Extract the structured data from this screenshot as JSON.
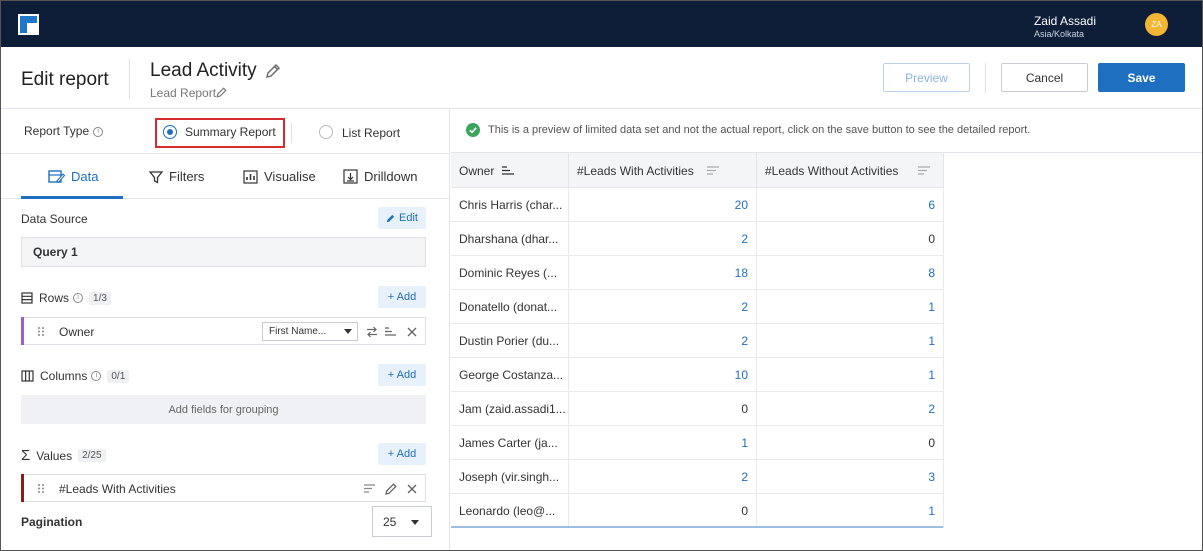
{
  "topbar": {
    "user_name": "Zaid Assadi",
    "user_timezone": "Asia/Kolkata",
    "avatar_initials": "ZA",
    "avatar_color": "#f2b632"
  },
  "header": {
    "page_title": "Edit report",
    "report_name": "Lead Activity",
    "report_subtitle": "Lead Report",
    "preview_label": "Preview",
    "cancel_label": "Cancel",
    "save_label": "Save"
  },
  "report_type": {
    "label": "Report Type",
    "options": [
      {
        "label": "Summary Report",
        "selected": true
      },
      {
        "label": "List Report",
        "selected": false
      }
    ]
  },
  "tabs": [
    {
      "label": "Data",
      "active": true,
      "icon": "data-icon"
    },
    {
      "label": "Filters",
      "active": false,
      "icon": "filter-icon"
    },
    {
      "label": "Visualise",
      "active": false,
      "icon": "chart-icon"
    },
    {
      "label": "Drilldown",
      "active": false,
      "icon": "drilldown-icon"
    }
  ],
  "data_source": {
    "label": "Data Source",
    "edit_label": "Edit",
    "query": "Query 1"
  },
  "rows_section": {
    "label": "Rows",
    "count": "1/3",
    "add_label": "+ Add",
    "items": [
      {
        "label": "Owner",
        "format": "First Name..."
      }
    ]
  },
  "columns_section": {
    "label": "Columns",
    "count": "0/1",
    "add_label": "+ Add",
    "placeholder": "Add fields for grouping"
  },
  "values_section": {
    "label": "Values",
    "count": "2/25",
    "add_label": "+ Add",
    "items": [
      {
        "label": "#Leads With Activities"
      }
    ]
  },
  "pagination": {
    "label": "Pagination",
    "value": "25"
  },
  "notice": {
    "text": "This is a preview of limited data set and not the actual report, click on the save button to see the detailed report."
  },
  "grid": {
    "columns": [
      "Owner",
      "#Leads With Activities",
      "#Leads Without Activities"
    ],
    "rows": [
      {
        "owner": "Chris Harris (char...",
        "with": "20",
        "without": "6"
      },
      {
        "owner": "Dharshana (dhar...",
        "with": "2",
        "without": "0"
      },
      {
        "owner": "Dominic Reyes (...",
        "with": "18",
        "without": "8"
      },
      {
        "owner": "Donatello (donat...",
        "with": "2",
        "without": "1"
      },
      {
        "owner": "Dustin Porier (du...",
        "with": "2",
        "without": "1"
      },
      {
        "owner": "George Costanza...",
        "with": "10",
        "without": "1"
      },
      {
        "owner": "Jam (zaid.assadi1...",
        "with": "0",
        "without": "2"
      },
      {
        "owner": "James Carter (ja...",
        "with": "1",
        "without": "0"
      },
      {
        "owner": "Joseph (vir.singh...",
        "with": "2",
        "without": "3"
      },
      {
        "owner": "Leonardo (leo@...",
        "with": "0",
        "without": "1"
      }
    ]
  },
  "colors": {
    "topbar": "#0e1e39",
    "accent": "#1f6fc0",
    "highlight_border": "#d82c2c",
    "rows_accent": "#a05cc8",
    "values_accent": "#8b1c1c",
    "success": "#3aa55d"
  }
}
